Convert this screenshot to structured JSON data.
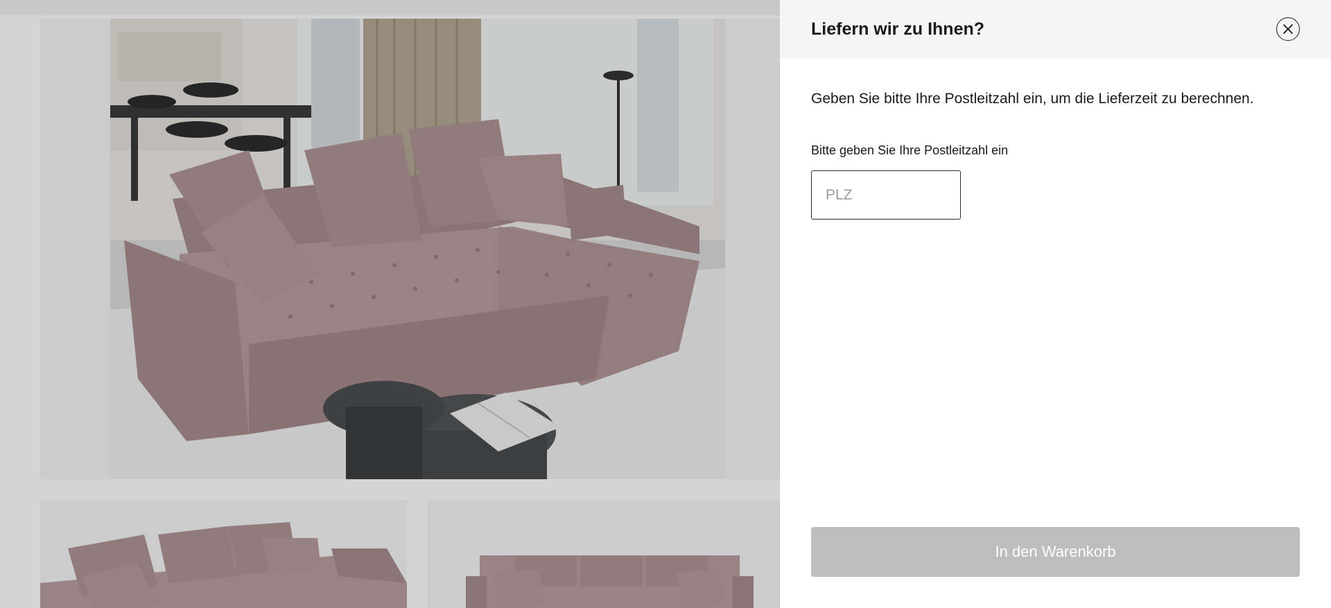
{
  "drawer": {
    "title": "Liefern wir zu Ihnen?",
    "close_icon": "close-circle-icon",
    "intro_text": "Geben Sie bitte Ihre Postleitzahl ein, um die Lieferzeit zu berechnen.",
    "field_label": "Bitte geben Sie Ihre Postleitzahl ein",
    "postal_code": {
      "value": "",
      "placeholder": "PLZ"
    },
    "add_to_cart_label": "In den Warenkorb",
    "add_to_cart_disabled": true
  },
  "background": {
    "overlay_color": "#000000",
    "product_color": "#ba9ea0"
  },
  "colors": {
    "drawer_header_bg": "#f5f5f5",
    "button_disabled_bg": "#bdbdbd",
    "text": "#1a1a1a"
  }
}
